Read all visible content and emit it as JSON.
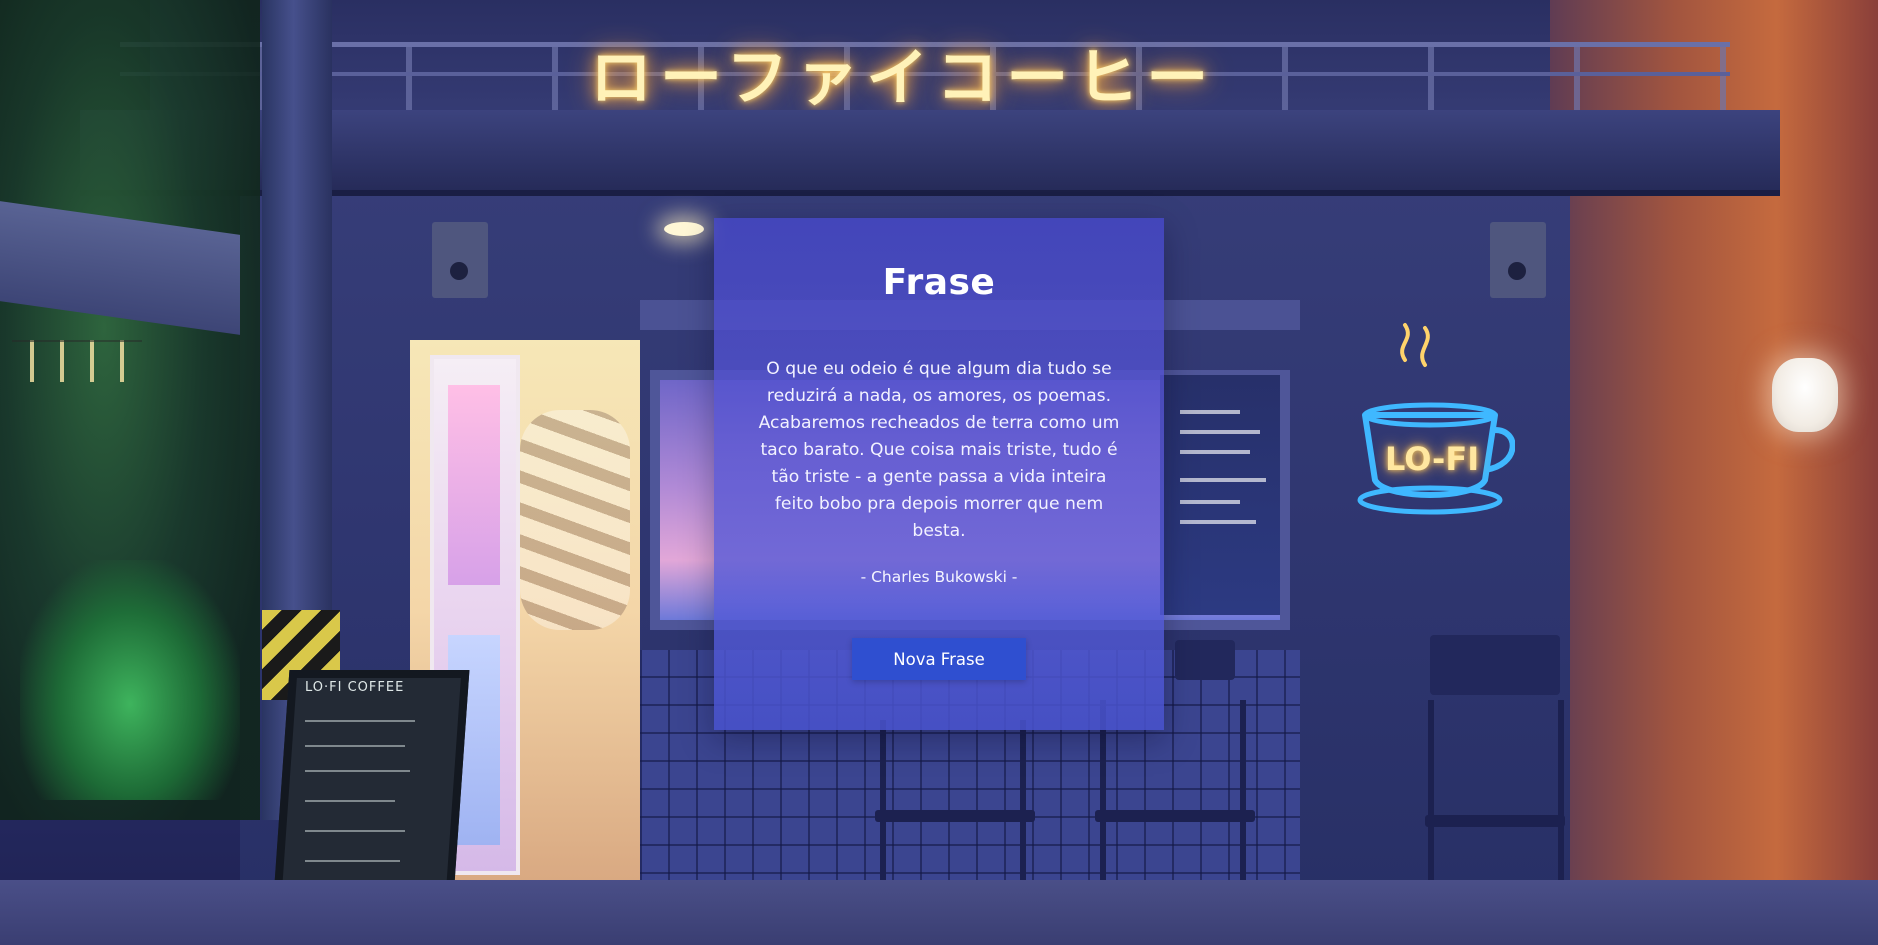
{
  "background": {
    "neon_sign": "ローファイコーヒー",
    "cup_sign": "LO-FI",
    "chalkboard_title": "LO·FI COFFEE"
  },
  "card": {
    "title": "Frase",
    "quote": "O que eu odeio é que algum dia tudo se reduzirá a nada, os amores, os poemas. Acabaremos recheados de terra como um taco barato. Que coisa mais triste, tudo é tão triste - a gente passa a vida inteira feito bobo pra depois morrer que nem besta.",
    "author": "- Charles Bukowski -",
    "button_label": "Nova Frase"
  },
  "colors": {
    "card_background": "#5a58d2",
    "button": "#2f4fd0",
    "neon": "#ffd36b"
  }
}
